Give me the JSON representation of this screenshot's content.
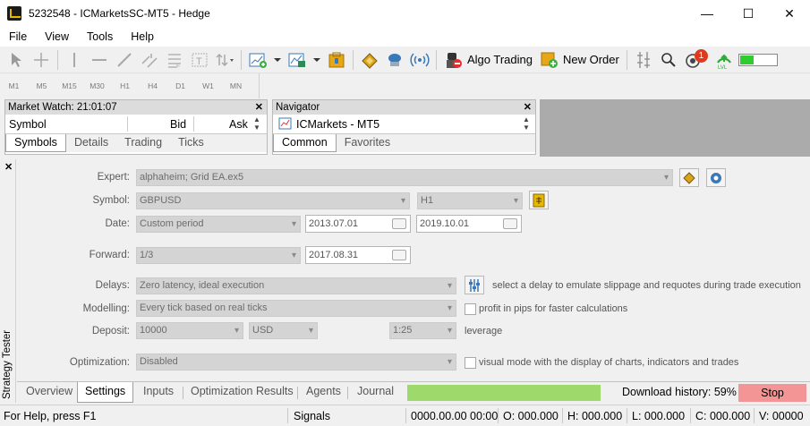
{
  "window": {
    "title": "5232548 - ICMarketsSC-MT5 - Hedge",
    "minimize": "—",
    "maximize": "☐",
    "close": "✕"
  },
  "menu": [
    "File",
    "View",
    "Tools",
    "Help"
  ],
  "toolbar": {
    "algo_trading": "Algo Trading",
    "new_order": "New Order",
    "notification_count": "1"
  },
  "timeframes": [
    "M1",
    "M5",
    "M15",
    "M30",
    "H1",
    "H4",
    "D1",
    "W1",
    "MN"
  ],
  "market_watch": {
    "title": "Market Watch: 21:01:07",
    "columns": [
      "Symbol",
      "Bid",
      "Ask"
    ],
    "tabs": [
      "Symbols",
      "Details",
      "Trading",
      "Ticks"
    ]
  },
  "navigator": {
    "title": "Navigator",
    "item": "ICMarkets - MT5",
    "tabs": [
      "Common",
      "Favorites"
    ]
  },
  "tester": {
    "side_label": "Strategy Tester",
    "expert": {
      "label": "Expert:",
      "value": "alphaheim; Grid EA.ex5"
    },
    "symbol": {
      "label": "Symbol:",
      "value": "GBPUSD",
      "timeframe": "H1"
    },
    "date": {
      "label": "Date:",
      "value": "Custom period",
      "from": "2013.07.01",
      "to": "2019.10.01"
    },
    "forward": {
      "label": "Forward:",
      "value": "1/3",
      "date": "2017.08.31"
    },
    "delays": {
      "label": "Delays:",
      "value": "Zero latency, ideal execution",
      "hint": "select a delay to emulate slippage and requotes during trade execution"
    },
    "modelling": {
      "label": "Modelling:",
      "value": "Every tick based on real ticks",
      "hint": "profit in pips for faster calculations"
    },
    "deposit": {
      "label": "Deposit:",
      "value": "10000",
      "currency": "USD",
      "leverage_value": "1:25",
      "leverage_label": "leverage"
    },
    "optimization": {
      "label": "Optimization:",
      "value": "Disabled",
      "hint": "visual mode with the display of charts, indicators and trades"
    }
  },
  "bottom_tabs": [
    "Overview",
    "Settings",
    "Inputs",
    "Optimization Results",
    "Agents",
    "Journal"
  ],
  "download": {
    "text": "Download history: 59%",
    "progress": 0.59,
    "stop": "Stop",
    "progress_color": "#9ed96b",
    "stop_color": "#f49595"
  },
  "status": {
    "help": "For Help, press F1",
    "signals": "Signals",
    "datetime": "0000.00.00 00:00",
    "open": "O: 000.000",
    "high": "H: 000.000",
    "low": "L: 000.000",
    "close": "C: 000.000",
    "volume": "V: 00000"
  }
}
